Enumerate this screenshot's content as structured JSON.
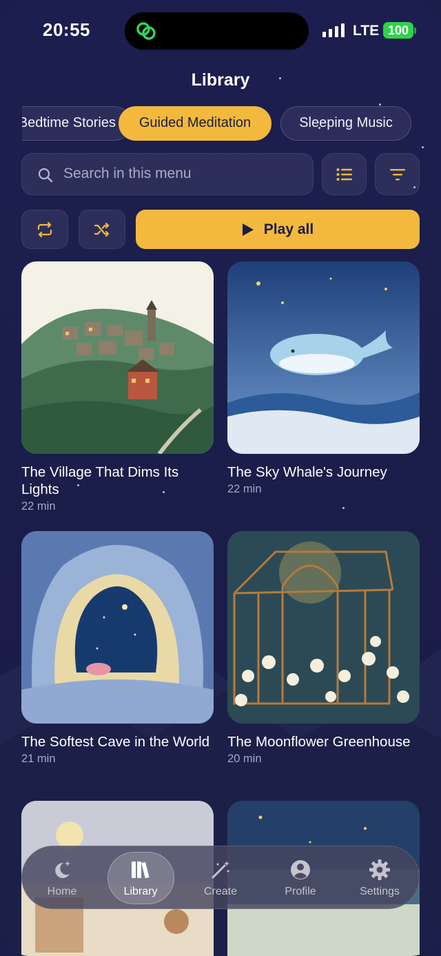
{
  "status_bar": {
    "time": "20:55",
    "network": "LTE",
    "battery": "100"
  },
  "header": {
    "title": "Library"
  },
  "tabs": [
    {
      "label": "Bedtime Stories",
      "active": false
    },
    {
      "label": "Guided Meditation",
      "active": true
    },
    {
      "label": "Sleeping Music",
      "active": false
    }
  ],
  "search": {
    "placeholder": "Search in this menu",
    "value": ""
  },
  "toolbar": {
    "list_view_icon": "list-icon",
    "sort_icon": "sort-icon",
    "repeat_icon": "repeat-icon",
    "shuffle_icon": "shuffle-icon",
    "play_all_label": "Play all"
  },
  "stories": [
    {
      "title": "The Village That Dims Its Lights",
      "duration": "22 min"
    },
    {
      "title": "The Sky Whale's Journey",
      "duration": "22 min"
    },
    {
      "title": "The Softest Cave in the World",
      "duration": "21 min"
    },
    {
      "title": "The Moonflower Greenhouse",
      "duration": "20 min"
    },
    {
      "title": "",
      "duration": ""
    },
    {
      "title": "",
      "duration": ""
    }
  ],
  "nav": [
    {
      "label": "Home",
      "icon": "moon-stars-icon",
      "active": false
    },
    {
      "label": "Library",
      "icon": "books-icon",
      "active": true
    },
    {
      "label": "Create",
      "icon": "magic-wand-icon",
      "active": false
    },
    {
      "label": "Profile",
      "icon": "person-icon",
      "active": false
    },
    {
      "label": "Settings",
      "icon": "gear-icon",
      "active": false
    }
  ],
  "colors": {
    "accent": "#f3b93e",
    "background": "#1b1d4a",
    "muted_text": "#a7a9c6"
  }
}
